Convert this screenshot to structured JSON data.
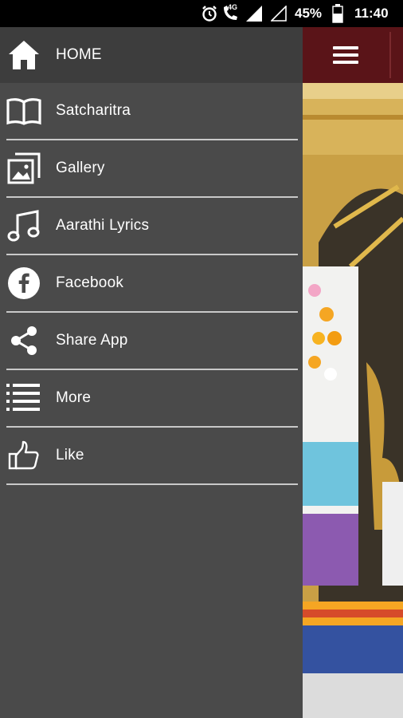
{
  "status_bar": {
    "network": "4G",
    "battery_percent": "45%",
    "time": "11:40"
  },
  "drawer": {
    "header": {
      "label": "HOME",
      "icon": "home-icon"
    },
    "items": [
      {
        "label": "Satcharitra",
        "icon": "book-icon"
      },
      {
        "label": "Gallery",
        "icon": "gallery-icon"
      },
      {
        "label": "Aarathi Lyrics",
        "icon": "music-note-icon"
      },
      {
        "label": "Facebook",
        "icon": "facebook-icon"
      },
      {
        "label": "Share App",
        "icon": "share-icon"
      },
      {
        "label": "More",
        "icon": "list-icon"
      },
      {
        "label": "Like",
        "icon": "thumbs-up-icon"
      }
    ]
  },
  "colors": {
    "drawer_bg": "#4a4a4a",
    "drawer_header_bg": "#3d3d3d",
    "toolbar_bg": "#5a1418",
    "divider": "#c9c9c9"
  }
}
